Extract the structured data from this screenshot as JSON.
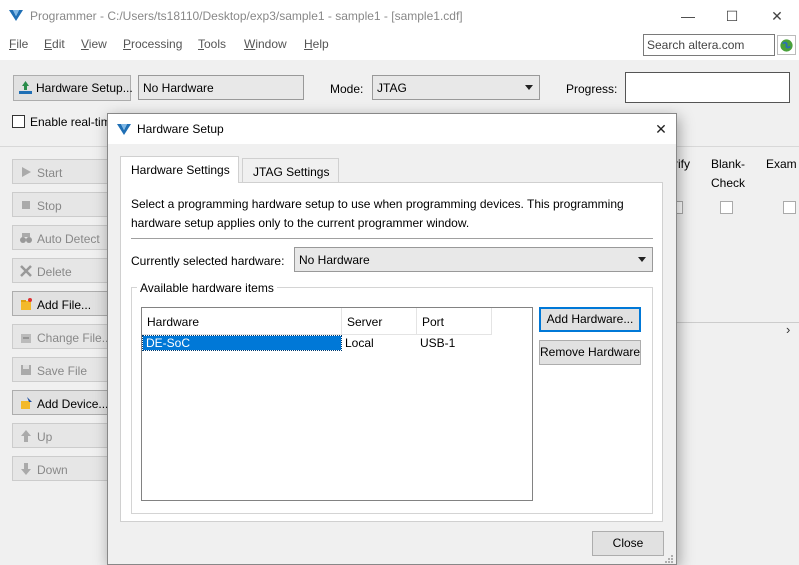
{
  "window": {
    "title": "Programmer - C:/Users/ts18110/Desktop/exp3/sample1 - sample1 - [sample1.cdf]",
    "minimize": "—",
    "maximize": "☐",
    "close": "✕"
  },
  "menu": [
    "File",
    "Edit",
    "View",
    "Processing",
    "Tools",
    "Window",
    "Help"
  ],
  "search": {
    "placeholder": "Search altera.com"
  },
  "toolbar": {
    "hardware_setup_label": "Hardware Setup...",
    "hardware_value": "No Hardware",
    "mode_label": "Mode:",
    "mode_value": "JTAG",
    "progress_label": "Progress:",
    "realtime_label": "Enable real-tim"
  },
  "side_buttons": [
    {
      "label": "Start",
      "enabled": false
    },
    {
      "label": "Stop",
      "enabled": false
    },
    {
      "label": "Auto Detect",
      "enabled": false
    },
    {
      "label": "Delete",
      "enabled": false
    },
    {
      "label": "Add File...",
      "enabled": true
    },
    {
      "label": "Change File...",
      "enabled": false
    },
    {
      "label": "Save File",
      "enabled": false
    },
    {
      "label": "Add Device...",
      "enabled": true
    },
    {
      "label": "Up",
      "enabled": false
    },
    {
      "label": "Down",
      "enabled": false
    }
  ],
  "grid_columns": [
    "rify",
    "Blank-\nCheck",
    "Exam"
  ],
  "dialog": {
    "title": "Hardware Setup",
    "tabs": [
      "Hardware Settings",
      "JTAG Settings"
    ],
    "description": "Select a programming hardware setup to use when programming devices. This programming hardware setup applies only to the current programmer window.",
    "current_hw_label": "Currently selected hardware:",
    "current_hw_value": "No Hardware",
    "group_label": "Available hardware items",
    "table_headers": [
      "Hardware",
      "Server",
      "Port"
    ],
    "rows": [
      {
        "hardware": "DE-SoC",
        "server": "Local",
        "port": "USB-1"
      }
    ],
    "add_hw_label": "Add Hardware...",
    "remove_hw_label": "Remove Hardware",
    "close_label": "Close"
  },
  "colors": {
    "accent": "#0078d7",
    "selection": "#0078d7",
    "selection_text": "#ffffff"
  }
}
